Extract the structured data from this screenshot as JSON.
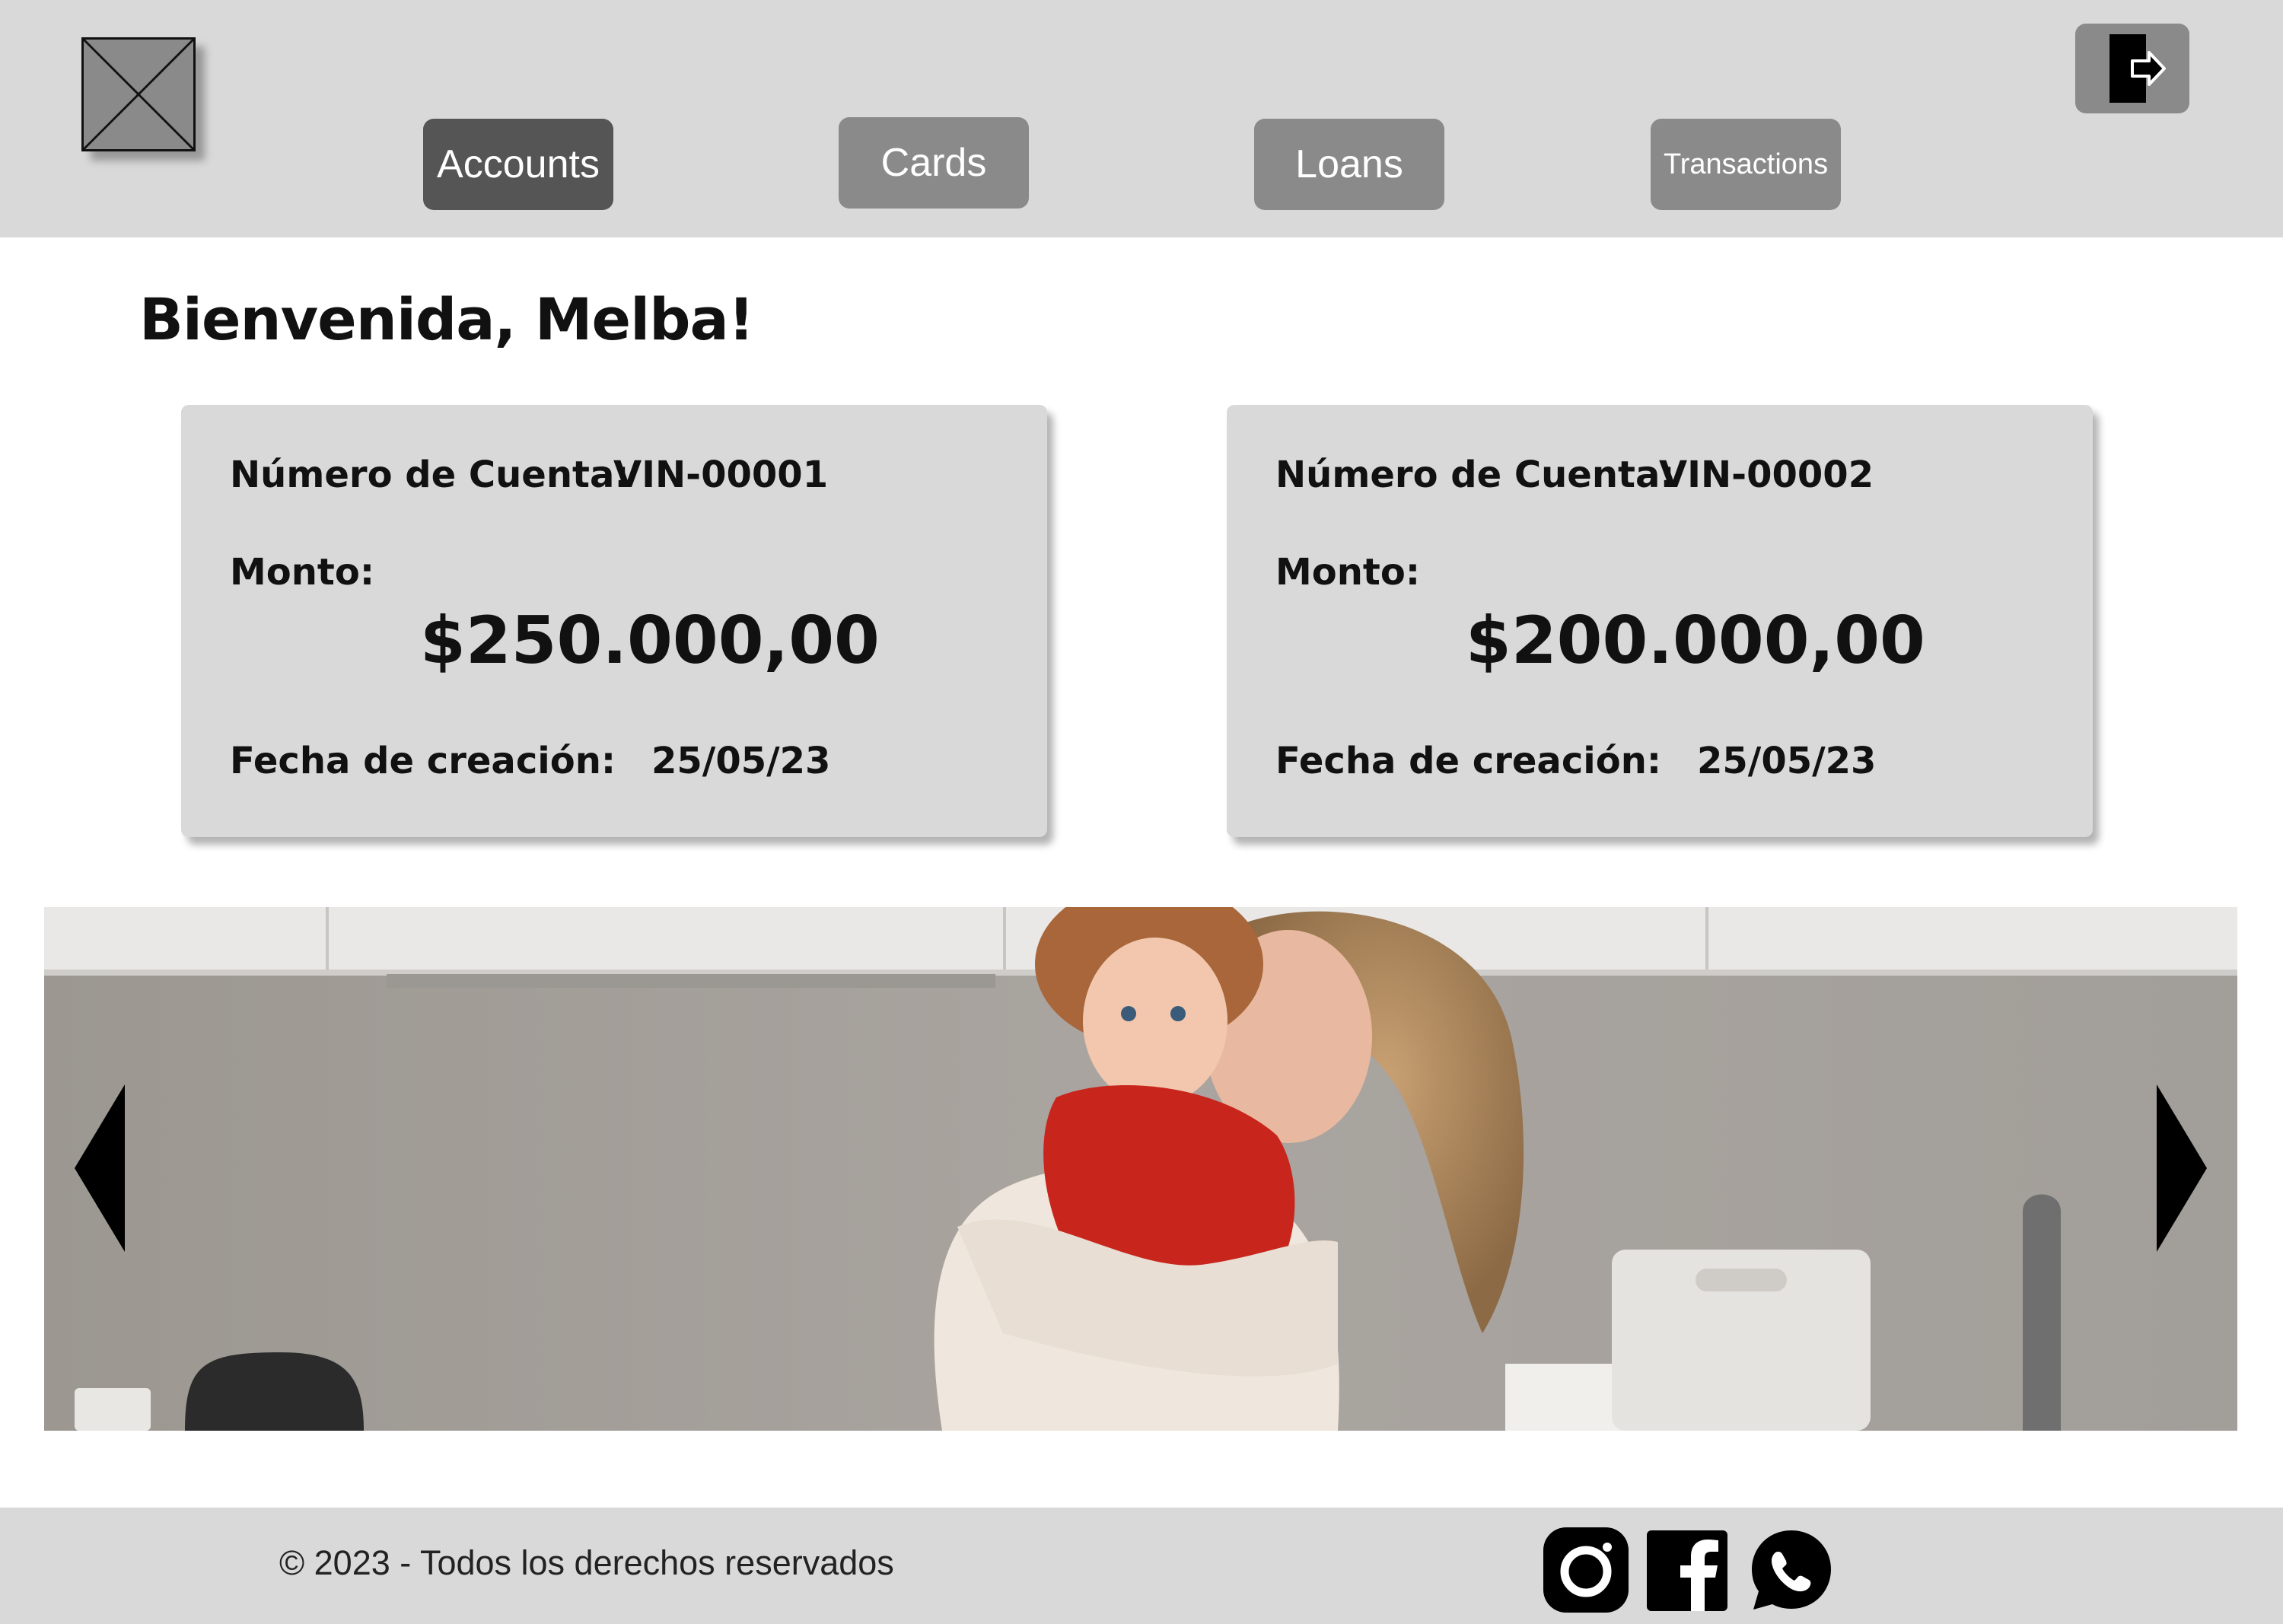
{
  "header": {
    "logo_icon": "image-placeholder-icon",
    "nav": [
      {
        "label": "Accounts",
        "active": true
      },
      {
        "label": "Cards",
        "active": false
      },
      {
        "label": "Loans",
        "active": false
      },
      {
        "label": "Transactions",
        "active": false
      }
    ],
    "logout_icon": "logout-icon"
  },
  "main": {
    "welcome": "Bienvenida, Melba!",
    "accounts": [
      {
        "account_label": "Número de Cuenta:",
        "account_number": "VIN-00001",
        "amount_label": "Monto:",
        "amount": "$250.000,00",
        "date_label": "Fecha de creación:",
        "date": "25/05/23"
      },
      {
        "account_label": "Número de Cuenta:",
        "account_number": "VIN-00002",
        "amount_label": "Monto:",
        "amount": "$200.000,00",
        "date_label": "Fecha de creación:",
        "date": "25/05/23"
      }
    ]
  },
  "banner": {
    "image": "mother-holding-child-in-kitchen-photo",
    "prev_icon": "triangle-left-icon",
    "next_icon": "triangle-right-icon"
  },
  "footer": {
    "copyright": "© 2023 - Todos los derechos reservados",
    "social": [
      "instagram-icon",
      "facebook-icon",
      "whatsapp-icon"
    ]
  },
  "colors": {
    "header_bg": "#d9d9d9",
    "nav_button": "#8a8a8a",
    "nav_active": "#555555",
    "card_bg": "#d9d9d9"
  }
}
